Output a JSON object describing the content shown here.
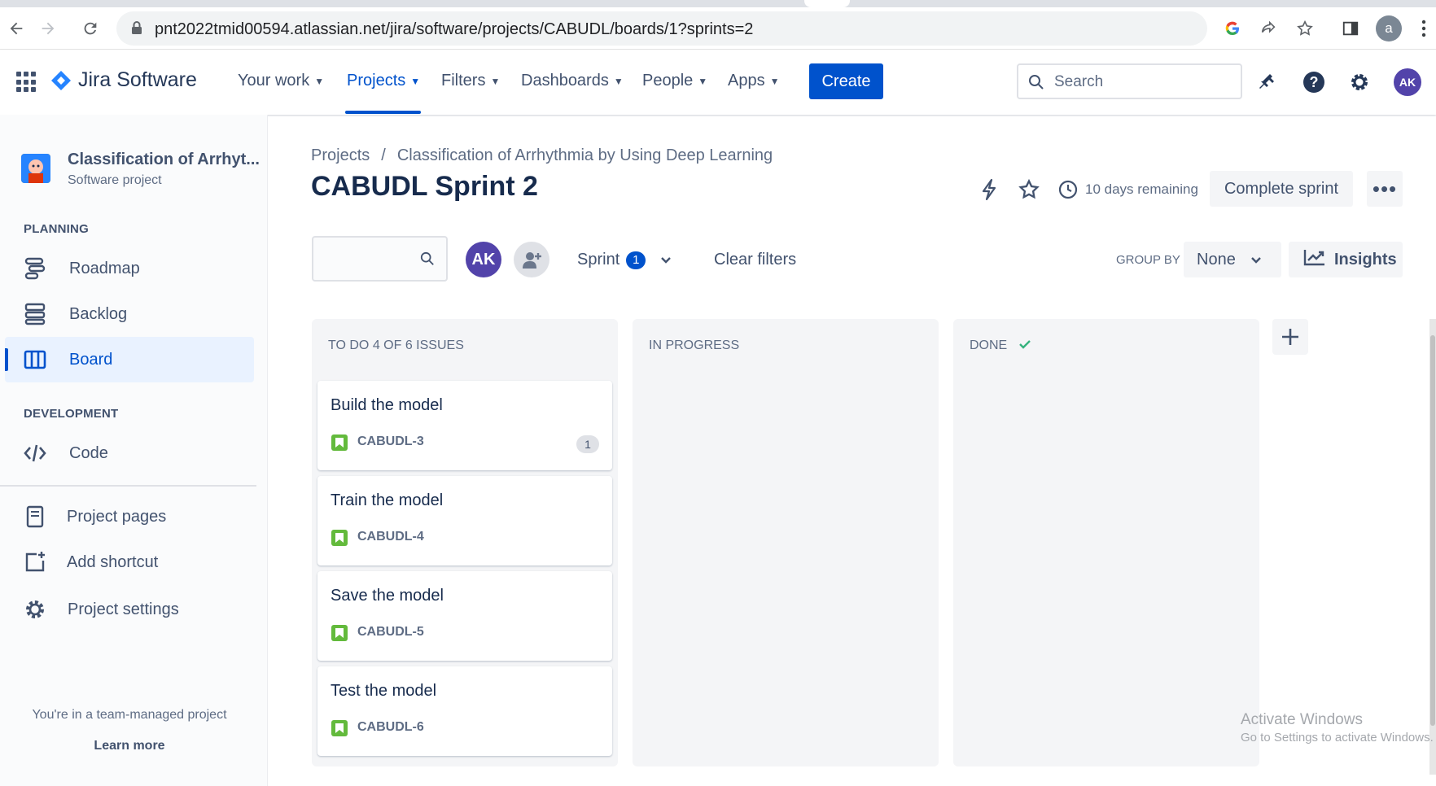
{
  "browser": {
    "url": "pnt2022tmid00594.atlassian.net/jira/software/projects/CABUDL/boards/1?sprints=2",
    "profile_initial": "a"
  },
  "topnav": {
    "product": "Jira Software",
    "items": [
      {
        "label": "Your work"
      },
      {
        "label": "Projects"
      },
      {
        "label": "Filters"
      },
      {
        "label": "Dashboards"
      },
      {
        "label": "People"
      },
      {
        "label": "Apps"
      }
    ],
    "create_label": "Create",
    "search_placeholder": "Search",
    "user_initials": "AK"
  },
  "sidebar": {
    "project_name": "Classification of Arrhyt...",
    "project_type": "Software project",
    "planning_heading": "PLANNING",
    "planning_items": [
      {
        "label": "Roadmap",
        "icon": "roadmap-icon"
      },
      {
        "label": "Backlog",
        "icon": "backlog-icon"
      },
      {
        "label": "Board",
        "icon": "board-icon"
      }
    ],
    "development_heading": "DEVELOPMENT",
    "development_items": [
      {
        "label": "Code",
        "icon": "code-icon"
      }
    ],
    "other_items": [
      {
        "label": "Project pages",
        "icon": "page-icon"
      },
      {
        "label": "Add shortcut",
        "icon": "add-shortcut-icon"
      },
      {
        "label": "Project settings",
        "icon": "gear-icon"
      }
    ],
    "footer_text": "You're in a team-managed project",
    "learn_more": "Learn more"
  },
  "main": {
    "breadcrumb": [
      "Projects",
      "/",
      "Classification of Arrhythmia by Using Deep Learning"
    ],
    "title": "CABUDL Sprint 2",
    "remaining": "10 days remaining",
    "complete_sprint": "Complete sprint",
    "more": "•••"
  },
  "filters": {
    "avatar_initials": "AK",
    "sprint_label": "Sprint",
    "sprint_count": "1",
    "clear_filters": "Clear filters",
    "group_by_label": "GROUP BY",
    "group_by_value": "None",
    "insights_label": "Insights"
  },
  "columns": [
    {
      "title": "TO DO 4 OF 6 ISSUES"
    },
    {
      "title": "IN PROGRESS"
    },
    {
      "title": "DONE"
    }
  ],
  "cards": [
    {
      "summary": "Build the model",
      "key": "CABUDL-3",
      "badge": "1"
    },
    {
      "summary": "Train the model",
      "key": "CABUDL-4"
    },
    {
      "summary": "Save the model",
      "key": "CABUDL-5"
    },
    {
      "summary": "Test the model",
      "key": "CABUDL-6"
    }
  ],
  "watermark": {
    "line1": "Activate Windows",
    "line2": "Go to Settings to activate Windows."
  },
  "colors": {
    "brand": "#0052cc",
    "story": "#63ba3c",
    "done_check": "#36b37e",
    "avatar": "#5243aa"
  }
}
